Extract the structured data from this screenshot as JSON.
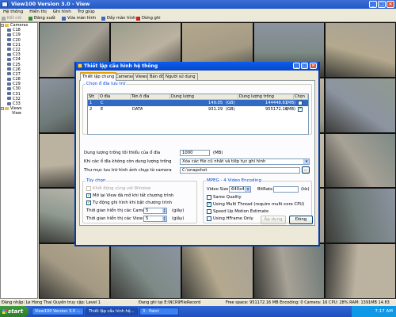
{
  "app": {
    "title": "View100 Version 3.0 - View"
  },
  "menu": [
    "Hệ thống",
    "Hiển thị",
    "Ghi hình",
    "Trợ giúp"
  ],
  "toolbar": {
    "connect": "Kết nối",
    "disconnect": "Đăng xuất",
    "fit_screen": "Vừa màn hình",
    "fill_screen": "Đầy màn hình",
    "stop_record": "Dừng ghi"
  },
  "tree": {
    "root": "Cameras",
    "cameras": [
      "C18",
      "C19",
      "C20",
      "C21",
      "C22",
      "C23",
      "C24",
      "C25",
      "C26",
      "C27",
      "C28",
      "C29",
      "C30",
      "C31",
      "C32",
      "C33"
    ],
    "views_root": "Views",
    "views": [
      "View"
    ]
  },
  "dialog": {
    "title": "Thiết lập cấu hình hệ thống",
    "tabs": [
      "Thiết lập chung",
      "Cameras",
      "Views",
      "Bản đồ",
      "Người sử dụng"
    ],
    "disk_group": "Chọn ổ đĩa lưu trữ",
    "columns": [
      "Stt",
      "Ổ đĩa",
      "Tên ổ đĩa",
      "Dung lượng",
      "Dung lượng trống",
      "Chọn"
    ],
    "rows": [
      {
        "stt": "1",
        "drive": "C",
        "name": "",
        "size": "149.05",
        "unit1": "(GB)",
        "free": "144448.81",
        "unit2": "(MB)",
        "checked": false
      },
      {
        "stt": "2",
        "drive": "E",
        "name": "DATA",
        "size": "931.29",
        "unit1": "(GB)",
        "free": "955172.16",
        "unit2": "(MB)",
        "checked": true
      }
    ],
    "min_free_label": "Dung lượng trống tối thiểu của ổ đĩa",
    "min_free_value": "1000",
    "min_free_unit": "(MB)",
    "full_disk_label": "Khi các ổ đĩa không còn dung lượng trống",
    "full_disk_value": "Xóa các file cũ nhất và tiếp tục ghi hình",
    "snapshot_label": "Thư mục lưu trữ hình ảnh chụp từ camera",
    "snapshot_value": "C:\\snapshot",
    "browse": "...",
    "options_group": "Tùy chọn",
    "opt_start_windows": "Khởi động cùng với Window",
    "opt_open_view": "Mở lại View đã mở khi tắt chương trình",
    "opt_auto_record": "Tự động ghi hình khi bật chương trình",
    "camera_time_label": "Thời gian hiển thị các Camera",
    "camera_time_value": "5",
    "camera_time_unit": "(giây)",
    "view_time_label": "Thời gian hiển thị các View",
    "view_time_value": "5",
    "view_time_unit": "(giây)",
    "mpeg_group": "MPEG - 4 Video Encoding",
    "video_size_label": "Video Size",
    "video_size_value": "640x480",
    "bitrate_label": "BitRate",
    "bitrate_value": "",
    "bitrate_unit": "(kb)",
    "same_quality": "Same Quality",
    "multi_thread": "Using Multi Thread (require multi-core CPU)",
    "speed_up": "Speed Up Motion Estimate",
    "hframe": "Using HFrame Only",
    "apply": "Áp dụng",
    "close": "Đóng"
  },
  "status": {
    "login": "Đăng nhập: Le Hong Thai  Quyền truy cập: Level 1",
    "recording": "Đang ghi tại E:\\NCR9FileRecord",
    "stats": "Free space: 951172.16 MB  Encoding: 0  Camera: 16  CPU: 28%  RAM: 1391MB  14.83 fps"
  },
  "taskbar": {
    "start": "start",
    "tasks": [
      "View100 Version 3.0 -...",
      "Thiết lập cấu hình hệ...",
      "3 - Paint"
    ],
    "clock": "7:17 AM"
  },
  "colors": {
    "title_blue": "#2357c6",
    "record_red": "#cc2020",
    "taskbar_blue": "#245edb",
    "start_green": "#3a8e3a"
  }
}
